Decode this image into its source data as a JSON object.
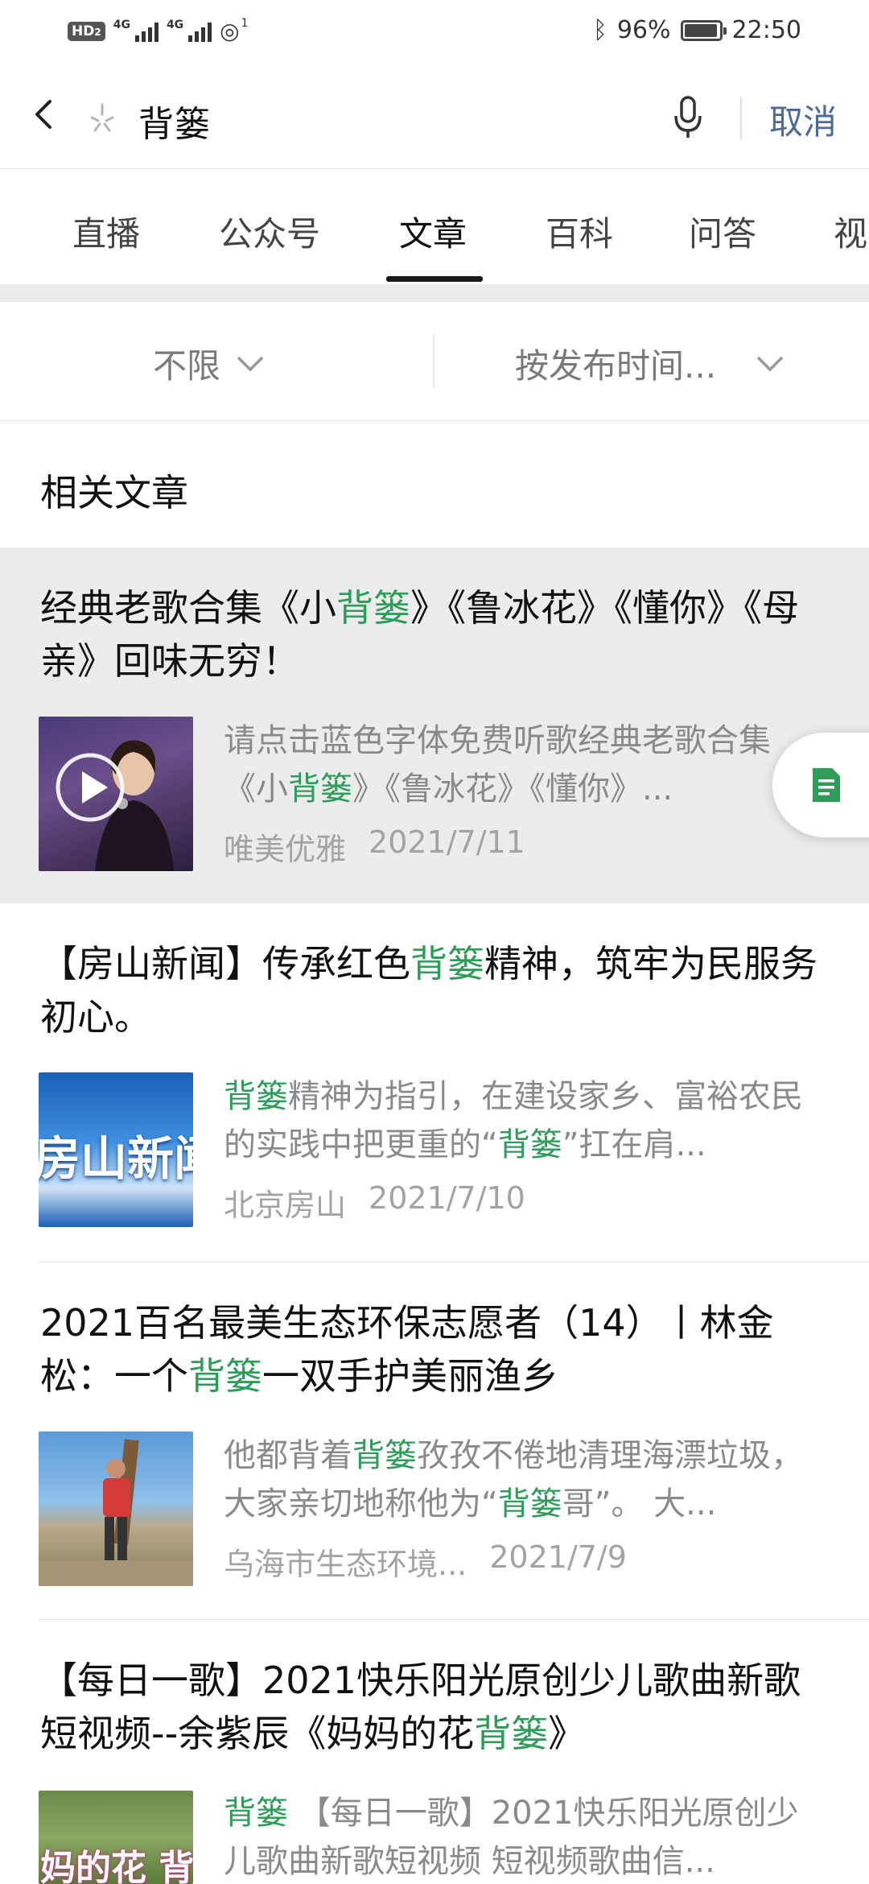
{
  "status_bar": {
    "hd": "HD",
    "hd_sub": "2",
    "sim1_label": "4G",
    "sim2_label": "4G",
    "wifi_sub": "1",
    "battery_text": "96%",
    "battery_level": 0.96,
    "time": "22:50"
  },
  "search": {
    "query": "背篓",
    "cancel_label": "取消"
  },
  "tabs": [
    {
      "label": "直播"
    },
    {
      "label": "公众号"
    },
    {
      "label": "文章"
    },
    {
      "label": "百科"
    },
    {
      "label": "问答"
    },
    {
      "label": "视"
    }
  ],
  "active_tab": "文章",
  "filters": {
    "range_label": "不限",
    "sort_label": "按发布时间..."
  },
  "section_title": "相关文章",
  "colors": {
    "keyword": "#2e9d5a",
    "cancel": "#4d6b99",
    "highlight_bg": "#ececec"
  },
  "articles": [
    {
      "title_parts": [
        "经典老歌合集《小",
        "背篓",
        "》《鲁冰花》《懂你》《母亲》回味无穷！"
      ],
      "snippet_parts": [
        "请点击蓝色字体免费听歌经典老歌合集《小",
        "背篓",
        "》《鲁冰花》《懂你》..."
      ],
      "source": "唯美优雅",
      "date": "2021/7/11",
      "thumb_icon": "play-icon"
    },
    {
      "title_parts": [
        "【房山新闻】传承红色",
        "背篓",
        "精神，筑牢为民服务初心。"
      ],
      "snippet_parts": [
        "",
        "背篓",
        "精神为指引，在建设家乡、富裕农民的实践中把更重的“",
        "背篓",
        "”扛在肩..."
      ],
      "source": "北京房山",
      "date": "2021/7/10",
      "thumb_text": "房山新闻"
    },
    {
      "title_parts": [
        "2021百名最美生态环保志愿者（14）丨林金松：一个",
        "背篓",
        "一双手护美丽渔乡"
      ],
      "snippet_parts": [
        "他都背着",
        "背篓",
        "孜孜不倦地清理海漂垃圾，大家亲切地称他为“",
        "背篓",
        "哥”。 大..."
      ],
      "source": "乌海市生态环境...",
      "date": "2021/7/9"
    },
    {
      "title_parts": [
        "【每日一歌】2021快乐阳光原创少儿歌曲新歌短视频--余紫辰《妈妈的花",
        "背篓",
        "》"
      ],
      "snippet_parts": [
        "",
        "背篓",
        " 【每日一歌】2021快乐阳光原创少儿歌曲新歌短视频 短视频歌曲信..."
      ],
      "thumb_text": "妈的花 背"
    }
  ]
}
